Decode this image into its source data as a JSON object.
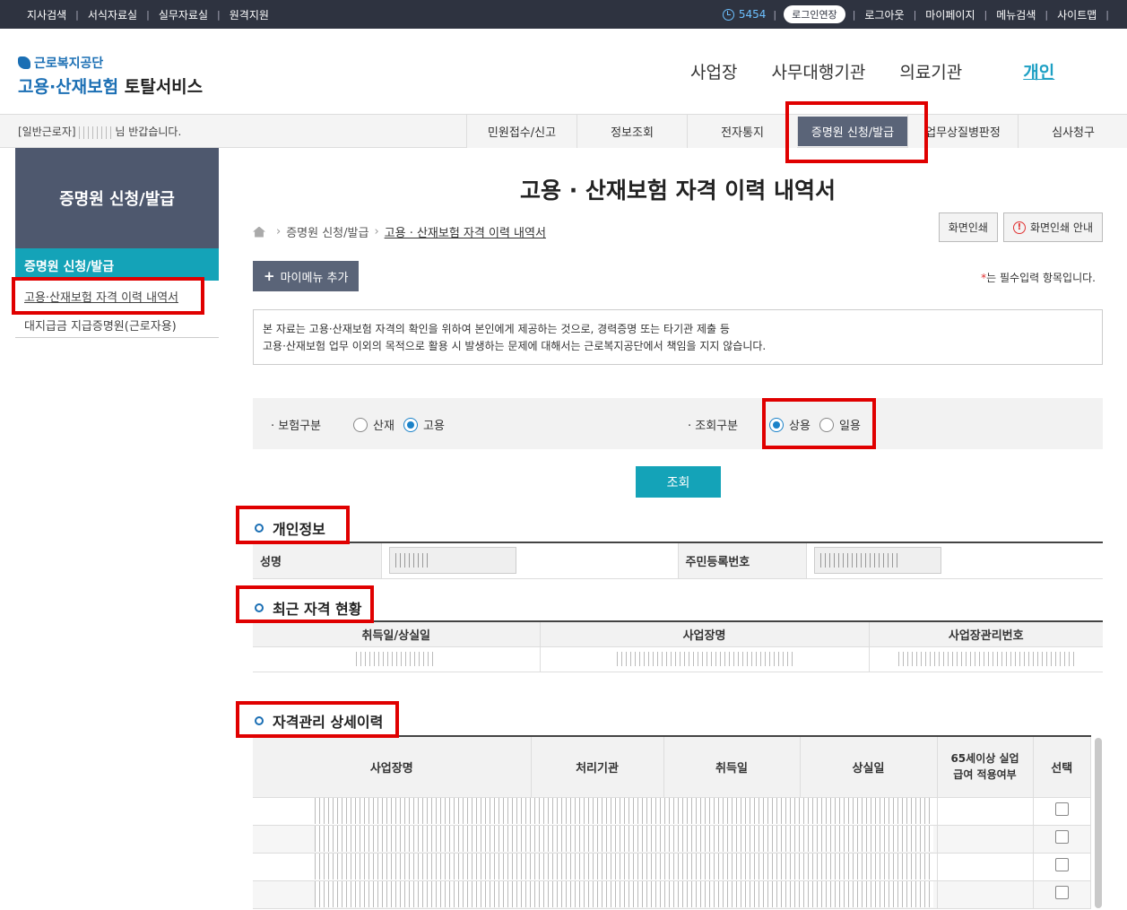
{
  "topbar": {
    "left_links": [
      "지사검색",
      "서식자료실",
      "실무자료실",
      "원격지원"
    ],
    "timer": "5454",
    "extend_label": "로그인연장",
    "right_links": [
      "로그아웃",
      "마이페이지",
      "메뉴검색",
      "사이트맵"
    ]
  },
  "logo": {
    "org": "근로복지공단",
    "service_main": "고용·산재보험",
    "service_sub": "토탈서비스"
  },
  "gnb": [
    "사업장",
    "사무대행기관",
    "의료기관",
    "개인"
  ],
  "welcome": {
    "prefix": "[일반근로자]",
    "suffix": "님 반갑습니다."
  },
  "snb": [
    "민원접수/신고",
    "정보조회",
    "전자통지",
    "증명원 신청/발급",
    "업무상질병판정",
    "심사청구"
  ],
  "lnb": {
    "title": "증명원 신청/발급",
    "section": "증명원 신청/발급",
    "items": [
      "고용·산재보험 자격 이력 내역서",
      "대지급금 지급증명원(근로자용)"
    ]
  },
  "page": {
    "title": "고용 · 산재보험 자격 이력 내역서",
    "breadcrumb": [
      "증명원 신청/발급",
      "고용 · 산재보험 자격 이력 내역서"
    ],
    "print_label": "화면인쇄",
    "print_guide_label": "화면인쇄 안내",
    "mymenu_label": "마이메뉴 추가",
    "required_note": "는 필수입력 항목입니다.",
    "notice_line1": "본 자료는 고용·산재보험 자격의 확인을 위하여 본인에게 제공하는 것으로, 경력증명 또는 타기관 제출 등",
    "notice_line2": "고용·산재보험 업무 이외의 목적으로 활용 시 발생하는 문제에 대해서는 근로복지공단에서 책임을 지지 않습니다."
  },
  "search": {
    "insurance_label": "보험구분",
    "insurance_options": [
      "산재",
      "고용"
    ],
    "insurance_selected": "고용",
    "query_label": "조회구분",
    "query_options": [
      "상용",
      "일용"
    ],
    "query_selected": "상용",
    "button_label": "조회"
  },
  "personal": {
    "title": "개인정보",
    "name_label": "성명",
    "rrn_label": "주민등록번호"
  },
  "recent": {
    "title": "최근 자격 현황",
    "headers": [
      "취득일/상실일",
      "사업장명",
      "사업장관리번호"
    ]
  },
  "detail": {
    "title": "자격관리 상세이력",
    "headers": [
      "사업장명",
      "처리기관",
      "취득일",
      "상실일",
      "65세이상 실업급여 적용여부",
      "선택"
    ]
  }
}
